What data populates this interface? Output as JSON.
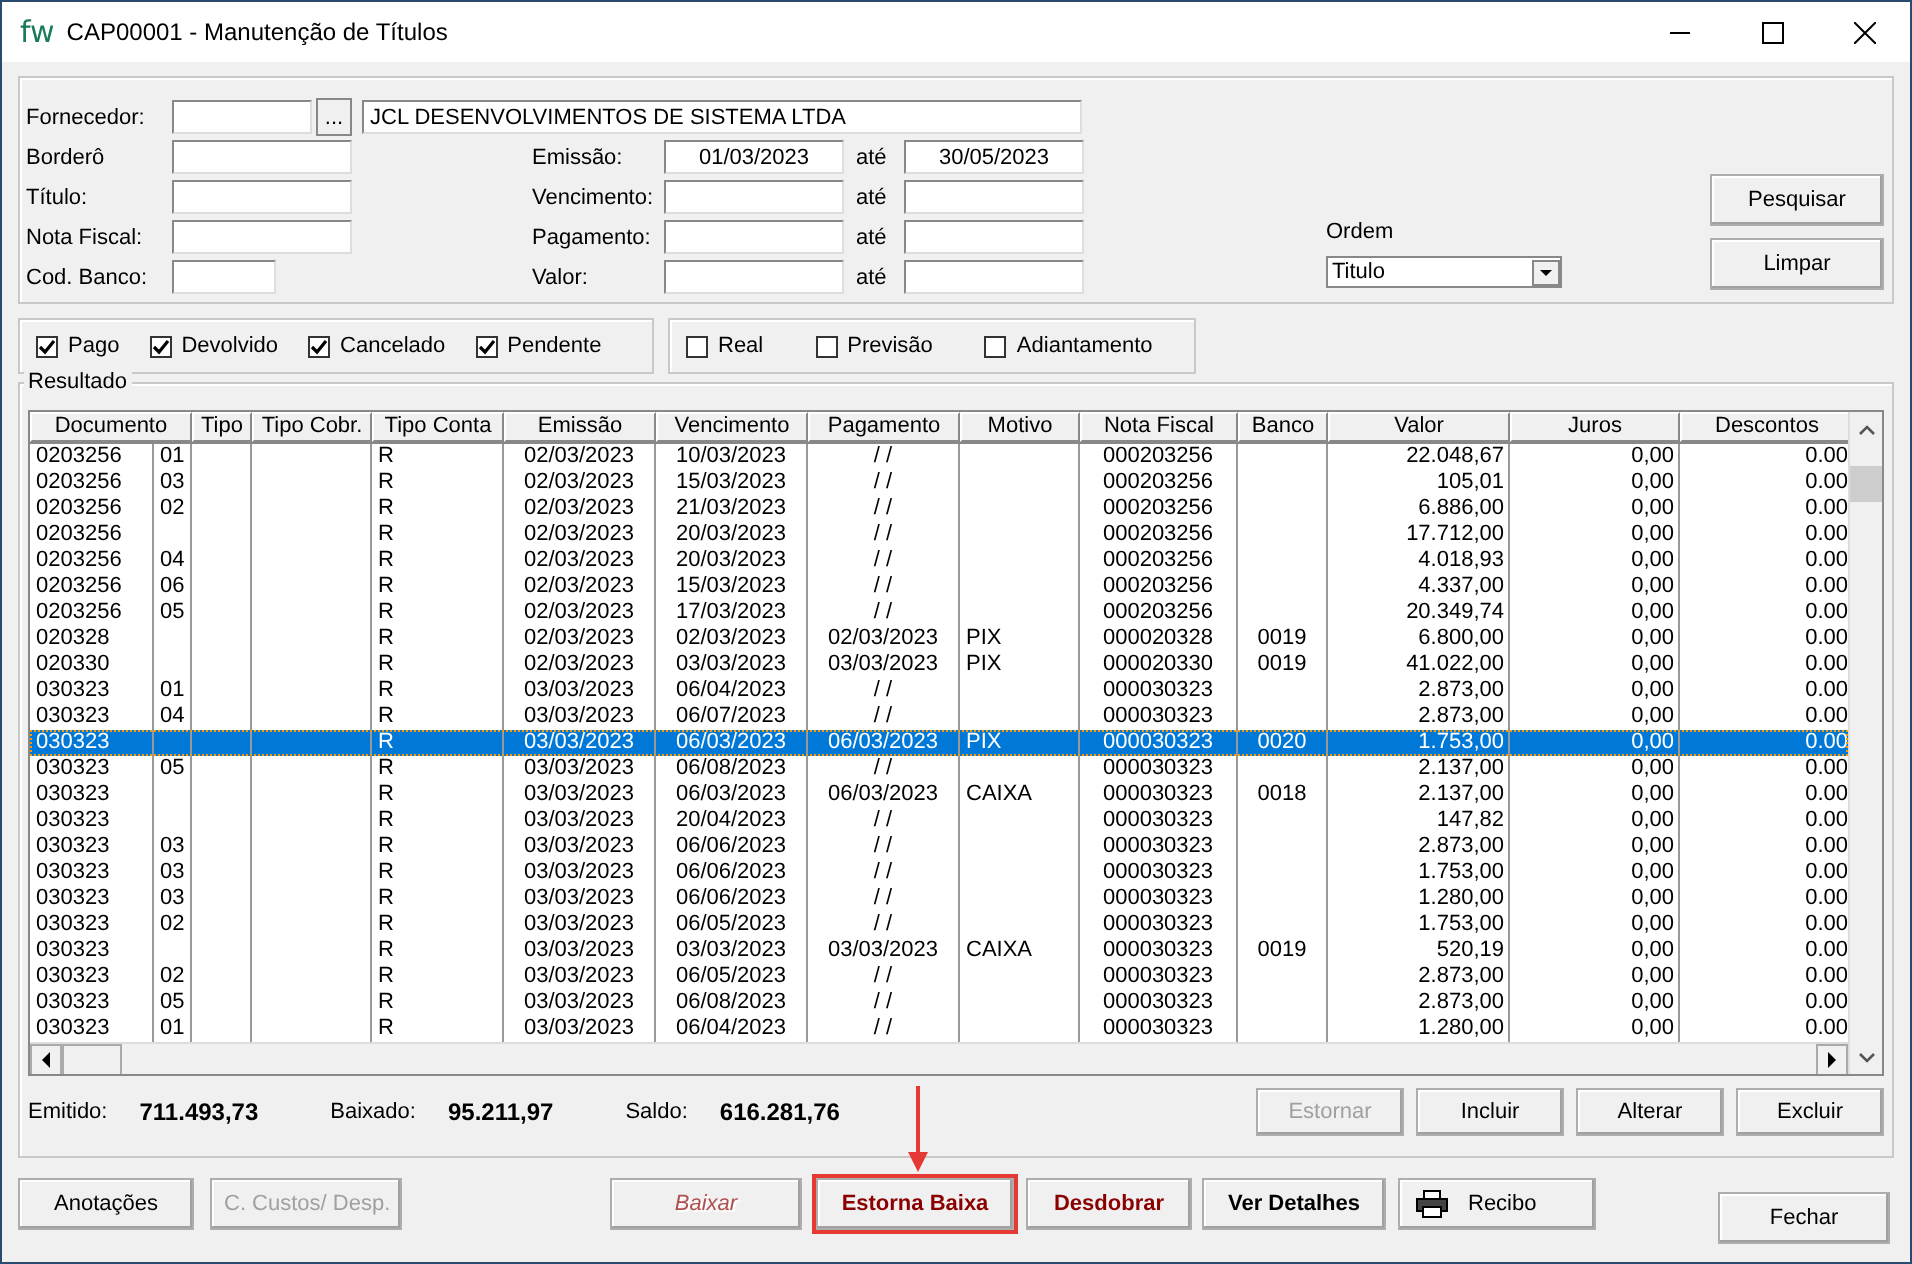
{
  "window": {
    "logo": "fw",
    "title": "CAP00001 - Manutenção de Títulos"
  },
  "filters": {
    "supplier": {
      "label": "Fornecedor:",
      "lookup_button": "...",
      "name": "JCL DESENVOLVIMENTOS DE SISTEMA LTDA"
    },
    "rows": [
      {
        "label": "Borderô",
        "range_label": "Emissão:",
        "from": "01/03/2023",
        "to_label": "até",
        "to": "30/05/2023"
      },
      {
        "label": "Título:",
        "range_label": "Vencimento:",
        "to_label": "até"
      },
      {
        "label": "Nota Fiscal:",
        "range_label": "Pagamento:",
        "to_label": "até"
      },
      {
        "label": "Cod. Banco:",
        "range_label": "Valor:",
        "to_label": "até"
      }
    ],
    "order": {
      "label": "Ordem",
      "value": "Titulo"
    },
    "buttons": [
      "Pesquisar",
      "Limpar"
    ]
  },
  "status_filters": [
    {
      "label": "Pago",
      "checked": true
    },
    {
      "label": "Devolvido",
      "checked": true
    },
    {
      "label": "Cancelado",
      "checked": true
    },
    {
      "label": "Pendente",
      "checked": true
    }
  ],
  "type_filters": [
    {
      "label": "Real",
      "checked": false
    },
    {
      "label": "Previsão",
      "checked": false
    },
    {
      "label": "Adiantamento",
      "checked": false
    }
  ],
  "results": {
    "title": "Resultado",
    "columns": [
      "Documento",
      "Tipo",
      "Tipo Cobr.",
      "Tipo Conta",
      "Emissão",
      "Vencimento",
      "Pagamento",
      "Motivo",
      "Nota Fiscal",
      "Banco",
      "Valor",
      "Juros",
      "Descontos"
    ],
    "rows": [
      {
        "selected": false,
        "documento": "0203256",
        "parcela": "01",
        "tipo_conta": "R",
        "emissao": "02/03/2023",
        "vencimento": "10/03/2023",
        "pagamento": "/  /",
        "nota_fiscal": "000203256",
        "valor": "22.048,67",
        "juros": "0,00",
        "descontos": "0.00"
      },
      {
        "selected": false,
        "documento": "0203256",
        "parcela": "03",
        "tipo_conta": "R",
        "emissao": "02/03/2023",
        "vencimento": "15/03/2023",
        "pagamento": "/  /",
        "nota_fiscal": "000203256",
        "valor": "105,01",
        "juros": "0,00",
        "descontos": "0.00"
      },
      {
        "selected": false,
        "documento": "0203256",
        "parcela": "02",
        "tipo_conta": "R",
        "emissao": "02/03/2023",
        "vencimento": "21/03/2023",
        "pagamento": "/  /",
        "nota_fiscal": "000203256",
        "valor": "6.886,00",
        "juros": "0,00",
        "descontos": "0.00"
      },
      {
        "selected": false,
        "documento": "0203256",
        "tipo_conta": "R",
        "emissao": "02/03/2023",
        "vencimento": "20/03/2023",
        "pagamento": "/  /",
        "nota_fiscal": "000203256",
        "valor": "17.712,00",
        "juros": "0,00",
        "descontos": "0.00"
      },
      {
        "selected": false,
        "documento": "0203256",
        "parcela": "04",
        "tipo_conta": "R",
        "emissao": "02/03/2023",
        "vencimento": "20/03/2023",
        "pagamento": "/  /",
        "nota_fiscal": "000203256",
        "valor": "4.018,93",
        "juros": "0,00",
        "descontos": "0.00"
      },
      {
        "selected": false,
        "documento": "0203256",
        "parcela": "06",
        "tipo_conta": "R",
        "emissao": "02/03/2023",
        "vencimento": "15/03/2023",
        "pagamento": "/  /",
        "nota_fiscal": "000203256",
        "valor": "4.337,00",
        "juros": "0,00",
        "descontos": "0.00"
      },
      {
        "selected": false,
        "documento": "0203256",
        "parcela": "05",
        "tipo_conta": "R",
        "emissao": "02/03/2023",
        "vencimento": "17/03/2023",
        "pagamento": "/  /",
        "nota_fiscal": "000203256",
        "valor": "20.349,74",
        "juros": "0,00",
        "descontos": "0.00"
      },
      {
        "selected": false,
        "documento": "020328",
        "tipo_conta": "R",
        "emissao": "02/03/2023",
        "vencimento": "02/03/2023",
        "pagamento": "02/03/2023",
        "motivo": "PIX",
        "nota_fiscal": "000020328",
        "banco": "0019",
        "valor": "6.800,00",
        "juros": "0,00",
        "descontos": "0.00"
      },
      {
        "selected": false,
        "documento": "020330",
        "tipo_conta": "R",
        "emissao": "02/03/2023",
        "vencimento": "03/03/2023",
        "pagamento": "03/03/2023",
        "motivo": "PIX",
        "nota_fiscal": "000020330",
        "banco": "0019",
        "valor": "41.022,00",
        "juros": "0,00",
        "descontos": "0.00"
      },
      {
        "selected": false,
        "documento": "030323",
        "parcela": "01",
        "tipo_conta": "R",
        "emissao": "03/03/2023",
        "vencimento": "06/04/2023",
        "pagamento": "/  /",
        "nota_fiscal": "000030323",
        "valor": "2.873,00",
        "juros": "0,00",
        "descontos": "0.00"
      },
      {
        "selected": false,
        "documento": "030323",
        "parcela": "04",
        "tipo_conta": "R",
        "emissao": "03/03/2023",
        "vencimento": "06/07/2023",
        "pagamento": "/  /",
        "nota_fiscal": "000030323",
        "valor": "2.873,00",
        "juros": "0,00",
        "descontos": "0.00"
      },
      {
        "selected": true,
        "documento": "030323",
        "tipo_conta": "R",
        "emissao": "03/03/2023",
        "vencimento": "06/03/2023",
        "pagamento": "06/03/2023",
        "motivo": "PIX",
        "nota_fiscal": "000030323",
        "banco": "0020",
        "valor": "1.753,00",
        "juros": "0,00",
        "descontos": "0.00"
      },
      {
        "selected": false,
        "documento": "030323",
        "parcela": "05",
        "tipo_conta": "R",
        "emissao": "03/03/2023",
        "vencimento": "06/08/2023",
        "pagamento": "/  /",
        "nota_fiscal": "000030323",
        "valor": "2.137,00",
        "juros": "0,00",
        "descontos": "0.00"
      },
      {
        "selected": false,
        "documento": "030323",
        "tipo_conta": "R",
        "emissao": "03/03/2023",
        "vencimento": "06/03/2023",
        "pagamento": "06/03/2023",
        "motivo": "CAIXA",
        "nota_fiscal": "000030323",
        "banco": "0018",
        "valor": "2.137,00",
        "juros": "0,00",
        "descontos": "0.00"
      },
      {
        "selected": false,
        "documento": "030323",
        "tipo_conta": "R",
        "emissao": "03/03/2023",
        "vencimento": "20/04/2023",
        "pagamento": "/  /",
        "nota_fiscal": "000030323",
        "valor": "147,82",
        "juros": "0,00",
        "descontos": "0.00"
      },
      {
        "selected": false,
        "documento": "030323",
        "parcela": "03",
        "tipo_conta": "R",
        "emissao": "03/03/2023",
        "vencimento": "06/06/2023",
        "pagamento": "/  /",
        "nota_fiscal": "000030323",
        "valor": "2.873,00",
        "juros": "0,00",
        "descontos": "0.00"
      },
      {
        "selected": false,
        "documento": "030323",
        "parcela": "03",
        "tipo_conta": "R",
        "emissao": "03/03/2023",
        "vencimento": "06/06/2023",
        "pagamento": "/  /",
        "nota_fiscal": "000030323",
        "valor": "1.753,00",
        "juros": "0,00",
        "descontos": "0.00"
      },
      {
        "selected": false,
        "documento": "030323",
        "parcela": "03",
        "tipo_conta": "R",
        "emissao": "03/03/2023",
        "vencimento": "06/06/2023",
        "pagamento": "/  /",
        "nota_fiscal": "000030323",
        "valor": "1.280,00",
        "juros": "0,00",
        "descontos": "0.00"
      },
      {
        "selected": false,
        "documento": "030323",
        "parcela": "02",
        "tipo_conta": "R",
        "emissao": "03/03/2023",
        "vencimento": "06/05/2023",
        "pagamento": "/  /",
        "nota_fiscal": "000030323",
        "valor": "1.753,00",
        "juros": "0,00",
        "descontos": "0.00"
      },
      {
        "selected": false,
        "documento": "030323",
        "tipo_conta": "R",
        "emissao": "03/03/2023",
        "vencimento": "03/03/2023",
        "pagamento": "03/03/2023",
        "motivo": "CAIXA",
        "nota_fiscal": "000030323",
        "banco": "0019",
        "valor": "520,19",
        "juros": "0,00",
        "descontos": "0.00"
      },
      {
        "selected": false,
        "documento": "030323",
        "parcela": "02",
        "tipo_conta": "R",
        "emissao": "03/03/2023",
        "vencimento": "06/05/2023",
        "pagamento": "/  /",
        "nota_fiscal": "000030323",
        "valor": "2.873,00",
        "juros": "0,00",
        "descontos": "0.00"
      },
      {
        "selected": false,
        "documento": "030323",
        "parcela": "05",
        "tipo_conta": "R",
        "emissao": "03/03/2023",
        "vencimento": "06/08/2023",
        "pagamento": "/  /",
        "nota_fiscal": "000030323",
        "valor": "2.873,00",
        "juros": "0,00",
        "descontos": "0.00"
      },
      {
        "selected": false,
        "documento": "030323",
        "parcela": "01",
        "tipo_conta": "R",
        "emissao": "03/03/2023",
        "vencimento": "06/04/2023",
        "pagamento": "/  /",
        "nota_fiscal": "000030323",
        "valor": "1.280,00",
        "juros": "0,00",
        "descontos": "0.00"
      }
    ]
  },
  "totals": [
    {
      "label": "Emitido:",
      "value": "711.493,73"
    },
    {
      "label": "Baixado:",
      "value": "95.211,97"
    },
    {
      "label": "Saldo:",
      "value": "616.281,76"
    }
  ],
  "grid_buttons": [
    {
      "label": "Estornar",
      "disabled": true
    },
    {
      "label": "Incluir",
      "disabled": false
    },
    {
      "label": "Alterar",
      "disabled": false
    },
    {
      "label": "Excluir",
      "disabled": false
    }
  ],
  "actions": [
    {
      "kind": "plain",
      "label": "Anotações",
      "disabled": false,
      "highlighted": false
    },
    {
      "kind": "plain",
      "label": "C. Custos/ Desp.",
      "disabled": true,
      "highlighted": false
    },
    {
      "kind": "red",
      "label": "Baixar",
      "disabled": true,
      "highlighted": false
    },
    {
      "kind": "red",
      "label": "Estorna Baixa",
      "disabled": false,
      "highlighted": true
    },
    {
      "kind": "red",
      "label": "Desdobrar",
      "disabled": false,
      "highlighted": false
    },
    {
      "kind": "bold",
      "label": "Ver Detalhes",
      "disabled": false,
      "highlighted": false
    },
    {
      "kind": "print",
      "label": "Recibo",
      "disabled": false,
      "highlighted": false
    }
  ],
  "close_button": "Fechar"
}
